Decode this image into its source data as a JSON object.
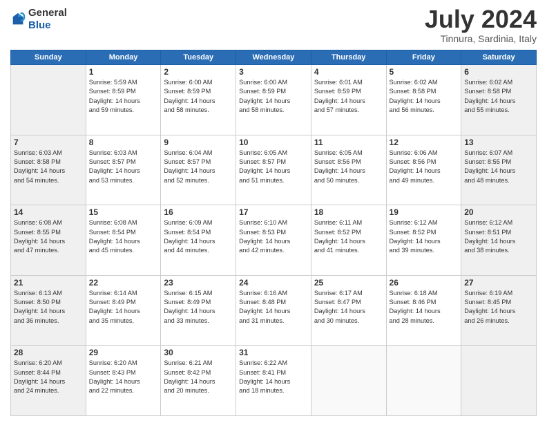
{
  "header": {
    "logo_general": "General",
    "logo_blue": "Blue",
    "title": "July 2024",
    "location": "Tinnura, Sardinia, Italy"
  },
  "days_of_week": [
    "Sunday",
    "Monday",
    "Tuesday",
    "Wednesday",
    "Thursday",
    "Friday",
    "Saturday"
  ],
  "weeks": [
    [
      {
        "day": "",
        "info": ""
      },
      {
        "day": "1",
        "info": "Sunrise: 5:59 AM\nSunset: 8:59 PM\nDaylight: 14 hours\nand 59 minutes."
      },
      {
        "day": "2",
        "info": "Sunrise: 6:00 AM\nSunset: 8:59 PM\nDaylight: 14 hours\nand 58 minutes."
      },
      {
        "day": "3",
        "info": "Sunrise: 6:00 AM\nSunset: 8:59 PM\nDaylight: 14 hours\nand 58 minutes."
      },
      {
        "day": "4",
        "info": "Sunrise: 6:01 AM\nSunset: 8:59 PM\nDaylight: 14 hours\nand 57 minutes."
      },
      {
        "day": "5",
        "info": "Sunrise: 6:02 AM\nSunset: 8:58 PM\nDaylight: 14 hours\nand 56 minutes."
      },
      {
        "day": "6",
        "info": "Sunrise: 6:02 AM\nSunset: 8:58 PM\nDaylight: 14 hours\nand 55 minutes."
      }
    ],
    [
      {
        "day": "7",
        "info": "Sunrise: 6:03 AM\nSunset: 8:58 PM\nDaylight: 14 hours\nand 54 minutes."
      },
      {
        "day": "8",
        "info": "Sunrise: 6:03 AM\nSunset: 8:57 PM\nDaylight: 14 hours\nand 53 minutes."
      },
      {
        "day": "9",
        "info": "Sunrise: 6:04 AM\nSunset: 8:57 PM\nDaylight: 14 hours\nand 52 minutes."
      },
      {
        "day": "10",
        "info": "Sunrise: 6:05 AM\nSunset: 8:57 PM\nDaylight: 14 hours\nand 51 minutes."
      },
      {
        "day": "11",
        "info": "Sunrise: 6:05 AM\nSunset: 8:56 PM\nDaylight: 14 hours\nand 50 minutes."
      },
      {
        "day": "12",
        "info": "Sunrise: 6:06 AM\nSunset: 8:56 PM\nDaylight: 14 hours\nand 49 minutes."
      },
      {
        "day": "13",
        "info": "Sunrise: 6:07 AM\nSunset: 8:55 PM\nDaylight: 14 hours\nand 48 minutes."
      }
    ],
    [
      {
        "day": "14",
        "info": "Sunrise: 6:08 AM\nSunset: 8:55 PM\nDaylight: 14 hours\nand 47 minutes."
      },
      {
        "day": "15",
        "info": "Sunrise: 6:08 AM\nSunset: 8:54 PM\nDaylight: 14 hours\nand 45 minutes."
      },
      {
        "day": "16",
        "info": "Sunrise: 6:09 AM\nSunset: 8:54 PM\nDaylight: 14 hours\nand 44 minutes."
      },
      {
        "day": "17",
        "info": "Sunrise: 6:10 AM\nSunset: 8:53 PM\nDaylight: 14 hours\nand 42 minutes."
      },
      {
        "day": "18",
        "info": "Sunrise: 6:11 AM\nSunset: 8:52 PM\nDaylight: 14 hours\nand 41 minutes."
      },
      {
        "day": "19",
        "info": "Sunrise: 6:12 AM\nSunset: 8:52 PM\nDaylight: 14 hours\nand 39 minutes."
      },
      {
        "day": "20",
        "info": "Sunrise: 6:12 AM\nSunset: 8:51 PM\nDaylight: 14 hours\nand 38 minutes."
      }
    ],
    [
      {
        "day": "21",
        "info": "Sunrise: 6:13 AM\nSunset: 8:50 PM\nDaylight: 14 hours\nand 36 minutes."
      },
      {
        "day": "22",
        "info": "Sunrise: 6:14 AM\nSunset: 8:49 PM\nDaylight: 14 hours\nand 35 minutes."
      },
      {
        "day": "23",
        "info": "Sunrise: 6:15 AM\nSunset: 8:49 PM\nDaylight: 14 hours\nand 33 minutes."
      },
      {
        "day": "24",
        "info": "Sunrise: 6:16 AM\nSunset: 8:48 PM\nDaylight: 14 hours\nand 31 minutes."
      },
      {
        "day": "25",
        "info": "Sunrise: 6:17 AM\nSunset: 8:47 PM\nDaylight: 14 hours\nand 30 minutes."
      },
      {
        "day": "26",
        "info": "Sunrise: 6:18 AM\nSunset: 8:46 PM\nDaylight: 14 hours\nand 28 minutes."
      },
      {
        "day": "27",
        "info": "Sunrise: 6:19 AM\nSunset: 8:45 PM\nDaylight: 14 hours\nand 26 minutes."
      }
    ],
    [
      {
        "day": "28",
        "info": "Sunrise: 6:20 AM\nSunset: 8:44 PM\nDaylight: 14 hours\nand 24 minutes."
      },
      {
        "day": "29",
        "info": "Sunrise: 6:20 AM\nSunset: 8:43 PM\nDaylight: 14 hours\nand 22 minutes."
      },
      {
        "day": "30",
        "info": "Sunrise: 6:21 AM\nSunset: 8:42 PM\nDaylight: 14 hours\nand 20 minutes."
      },
      {
        "day": "31",
        "info": "Sunrise: 6:22 AM\nSunset: 8:41 PM\nDaylight: 14 hours\nand 18 minutes."
      },
      {
        "day": "",
        "info": ""
      },
      {
        "day": "",
        "info": ""
      },
      {
        "day": "",
        "info": ""
      }
    ]
  ]
}
